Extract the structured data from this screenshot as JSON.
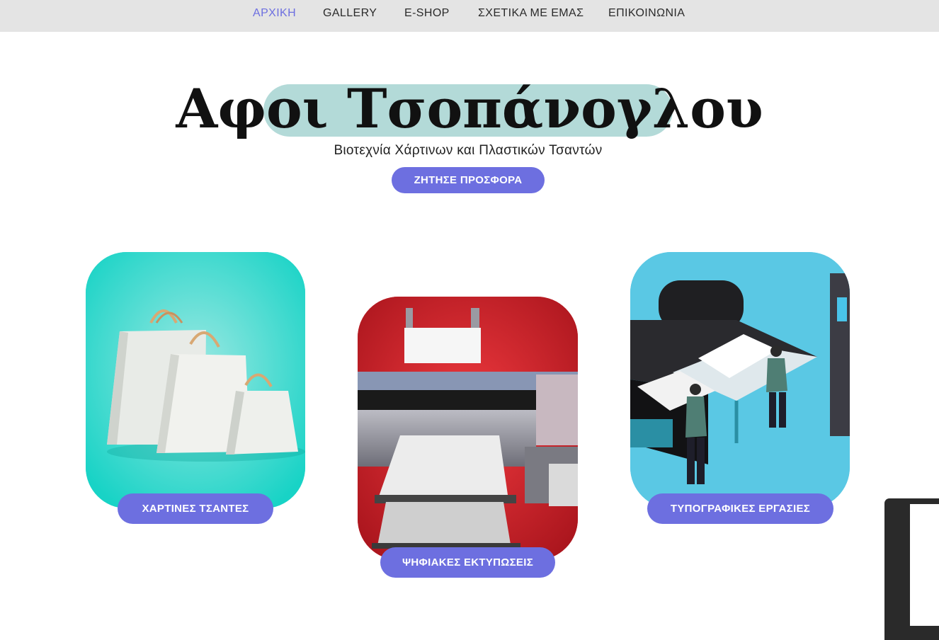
{
  "nav": {
    "items": [
      {
        "label": "ΑΡΧΙΚΗ",
        "active": true
      },
      {
        "label": "GALLERY",
        "active": false
      },
      {
        "label": "E-SHOP",
        "active": false
      },
      {
        "label": "ΣΧΕΤΙΚΑ ΜΕ ΕΜΑΣ",
        "active": false
      },
      {
        "label": "ΕΠΙΚΟΙΝΩΝΙΑ",
        "active": false
      }
    ]
  },
  "hero": {
    "title": "Αφοι Τσοπάνογλου",
    "subtitle": "Βιοτεχνία Χάρτινων και Πλαστικών Τσαντών",
    "cta_label": "ΖΗΤΗΣΕ ΠΡΟΣΦΟΡΑ"
  },
  "cards": [
    {
      "label": "ΧΑΡΤΙΝΕΣ ΤΣΑΝΤΕΣ",
      "image": "paper-bags-image"
    },
    {
      "label": "ΨΗΦΙΑΚΕΣ ΕΚΤΥΠΩΣΕΙΣ",
      "image": "printer-image"
    },
    {
      "label": "ΤΥΠΟΓΡΑΦΙΚΕΣ ΕΡΓΑΣΙΕΣ",
      "image": "print-workers-image"
    }
  ],
  "colors": {
    "accent": "#6d6fe0",
    "nav_active": "#6d6fe0",
    "nav_bg": "#e4e4e4",
    "title_highlight": "#b3dad8",
    "card1_bg": "#2ed8c8",
    "card2_bg": "#d8232b",
    "card3_bg": "#5ac8e4"
  }
}
